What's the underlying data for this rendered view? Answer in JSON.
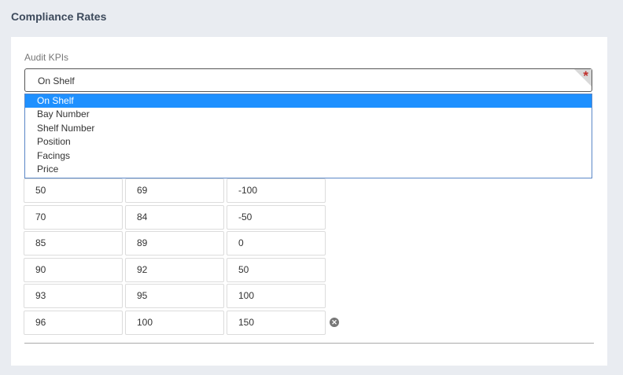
{
  "page": {
    "title": "Compliance Rates"
  },
  "kpi": {
    "label": "Audit KPIs",
    "selected": "On Shelf",
    "required_mark": "*",
    "options": [
      "On Shelf",
      "Bay Number",
      "Shelf Number",
      "Position",
      "Facings",
      "Price"
    ],
    "selected_index": 0
  },
  "rates": {
    "rows": [
      {
        "from": "50",
        "to": "69",
        "score": "-100"
      },
      {
        "from": "70",
        "to": "84",
        "score": "-50"
      },
      {
        "from": "85",
        "to": "89",
        "score": "0"
      },
      {
        "from": "90",
        "to": "92",
        "score": "50"
      },
      {
        "from": "93",
        "to": "95",
        "score": "100"
      },
      {
        "from": "96",
        "to": "100",
        "score": "150"
      }
    ],
    "remove_icon": "close-circle-icon"
  }
}
